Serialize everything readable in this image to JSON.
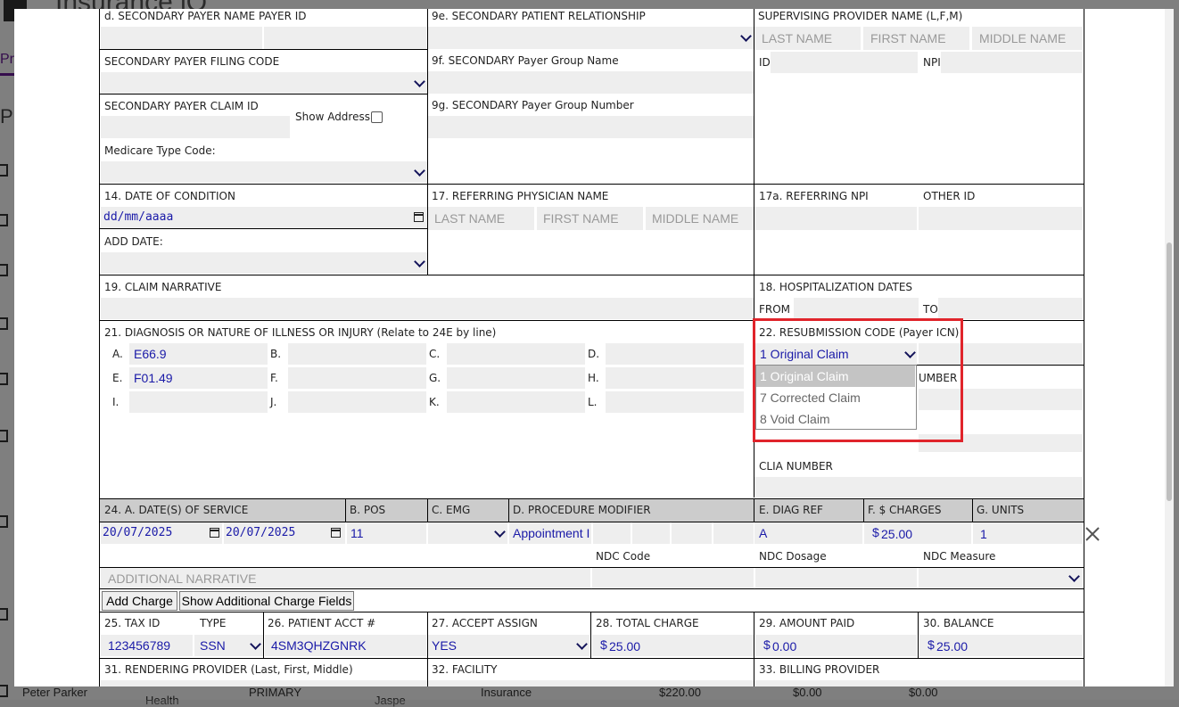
{
  "background": {
    "app_title": "Insurance iQ",
    "tab_fragment": "Pr",
    "heading_fragment": "P",
    "row": {
      "name": "Peter Parker",
      "col1": "Health",
      "col2": "PRIMARY",
      "col3": "Jaspe",
      "col4": "Insurance",
      "col5": "$220.00",
      "col6": "$0.00",
      "col7": "$0.00"
    }
  },
  "secondary": {
    "payer_name_label": "d. SECONDARY PAYER NAME PAYER ID",
    "patient_relationship_label": "9e. SECONDARY PATIENT RELATIONSHIP",
    "filing_code_label": "SECONDARY PAYER FILING CODE",
    "group_name_label": "9f. SECONDARY Payer Group Name",
    "claim_id_label": "SECONDARY PAYER CLAIM ID",
    "show_address_label": "Show Address",
    "group_number_label": "9g. SECONDARY Payer Group Number",
    "medicare_type_label": "Medicare Type Code:"
  },
  "supervising": {
    "label": "SUPERVISING PROVIDER NAME (L,F,M)",
    "last_placeholder": "LAST NAME",
    "first_placeholder": "FIRST NAME",
    "middle_placeholder": "MIDDLE NAME",
    "id_label": "ID",
    "npi_label": "NPI"
  },
  "condition": {
    "date_label": "14. DATE OF CONDITION",
    "date_placeholder": "dd/mm/aaaa",
    "add_date_label": "ADD DATE:"
  },
  "referring": {
    "label": "17. REFERRING PHYSICIAN NAME",
    "last_placeholder": "LAST NAME",
    "first_placeholder": "FIRST NAME",
    "middle_placeholder": "MIDDLE NAME",
    "npi_label": "17a. REFERRING NPI",
    "other_id_label": "OTHER ID"
  },
  "narrative": {
    "label": "19. CLAIM NARRATIVE"
  },
  "hospitalization": {
    "label": "18. HOSPITALIZATION DATES",
    "from_label": "FROM",
    "to_label": "TO"
  },
  "diagnosis": {
    "label": "21. DIAGNOSIS OR NATURE OF ILLNESS OR INJURY (Relate to 24E by line)",
    "codes": [
      {
        "letter": "A.",
        "value": "E66.9"
      },
      {
        "letter": "B.",
        "value": ""
      },
      {
        "letter": "C.",
        "value": ""
      },
      {
        "letter": "D.",
        "value": ""
      },
      {
        "letter": "E.",
        "value": "F01.49"
      },
      {
        "letter": "F.",
        "value": ""
      },
      {
        "letter": "G.",
        "value": ""
      },
      {
        "letter": "H.",
        "value": ""
      },
      {
        "letter": "I.",
        "value": ""
      },
      {
        "letter": "J.",
        "value": ""
      },
      {
        "letter": "K.",
        "value": ""
      },
      {
        "letter": "L.",
        "value": ""
      }
    ]
  },
  "resubmission": {
    "label": "22. RESUBMISSION CODE (Payer ICN)",
    "selected": "1 Original Claim",
    "options": [
      "1 Original Claim",
      "7 Corrected Claim",
      "8 Void Claim"
    ],
    "partial_label": "UMBER",
    "clia_label": "CLIA NUMBER"
  },
  "services": {
    "headers": {
      "date": "24. A. DATE(S) OF SERVICE",
      "pos": "B. POS",
      "emg": "C. EMG",
      "modifier": "D. PROCEDURE MODIFIER",
      "diag_ref": "E. DIAG REF",
      "charges": "F. $ CHARGES",
      "units": "G. UNITS"
    },
    "row": {
      "from_date": "20/07/2025",
      "to_date": "20/07/2025",
      "pos": "11",
      "procedure": "Appointment I",
      "diag_ref": "A",
      "charge": "25.00",
      "units": "1"
    },
    "ndc_code_label": "NDC Code",
    "ndc_dosage_label": "NDC Dosage",
    "ndc_measure_label": "NDC Measure",
    "additional_narrative_placeholder": "ADDITIONAL NARRATIVE",
    "add_charge_button": "Add Charge",
    "show_fields_button": "Show Additional Charge Fields"
  },
  "totals": {
    "tax_id_label": "25. TAX ID",
    "type_label": "TYPE",
    "patient_acct_label": "26. PATIENT ACCT #",
    "accept_assign_label": "27. ACCEPT ASSIGN",
    "total_charge_label": "28. TOTAL CHARGE",
    "amount_paid_label": "29. AMOUNT PAID",
    "balance_label": "30. BALANCE",
    "tax_id": "123456789",
    "type": "SSN",
    "patient_acct": "4SM3QHZGNRK",
    "accept_assign": "YES",
    "total_charge": "25.00",
    "amount_paid": "0.00",
    "balance": "25.00",
    "currency": "$"
  },
  "providers": {
    "rendering_label": "31. RENDERING PROVIDER (Last, First, Middle)",
    "facility_label": "32. FACILITY",
    "billing_label": "33. BILLING PROVIDER"
  },
  "colors": {
    "highlight": "#e0242b",
    "value_text": "#1a1aa8",
    "field_bg": "#eeeeee"
  }
}
